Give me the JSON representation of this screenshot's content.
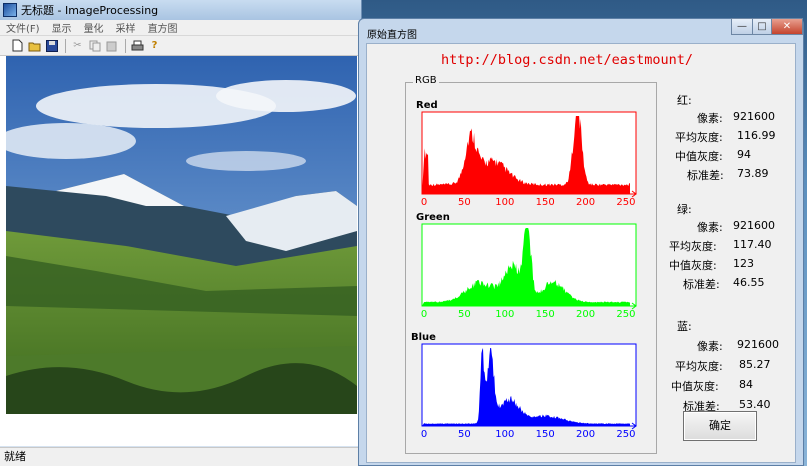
{
  "main_window": {
    "title": "无标题 - ImageProcessing",
    "menu": [
      "文件(F)",
      "显示",
      "量化",
      "采样",
      "直方图"
    ],
    "toolbar_icons": [
      "new-file-icon",
      "open-folder-icon",
      "save-icon",
      "cut-icon",
      "copy-icon",
      "paste-icon",
      "print-icon",
      "help-icon"
    ],
    "status": "就绪"
  },
  "dialog": {
    "title": "原始直方图",
    "buttons": {
      "minimize": "—",
      "maximize": "□",
      "close": "✕"
    },
    "url": "http://blog.csdn.net/eastmount/",
    "group_label": "RGB",
    "ok_label": "确定"
  },
  "histograms": [
    {
      "label": "Red",
      "color": "#ff0000",
      "ticks": [
        "0",
        "50",
        "100",
        "150",
        "200",
        "250"
      ]
    },
    {
      "label": "Green",
      "color": "#00ff00",
      "ticks": [
        "0",
        "50",
        "100",
        "150",
        "200",
        "250"
      ]
    },
    {
      "label": "Blue",
      "color": "#0000ff",
      "ticks": [
        "0",
        "50",
        "100",
        "150",
        "200",
        "250"
      ]
    }
  ],
  "stats": {
    "red": {
      "heading": "红:",
      "pixels_label": "像素:",
      "pixels": "921600",
      "mean_label": "平均灰度:",
      "mean": "116.99",
      "median_label": "中值灰度:",
      "median": "94",
      "std_label": "标准差:",
      "std": "73.89"
    },
    "green": {
      "heading": "绿:",
      "pixels_label": "像素:",
      "pixels": "921600",
      "mean_label": "平均灰度:",
      "mean": "117.40",
      "median_label": "中值灰度:",
      "median": "123",
      "std_label": "标准差:",
      "std": "46.55"
    },
    "blue": {
      "heading": "蓝:",
      "pixels_label": "像素:",
      "pixels": "921600",
      "mean_label": "平均灰度:",
      "mean": "85.27",
      "median_label": "中值灰度:",
      "median": "84",
      "std_label": "标准差:",
      "std": "53.40"
    }
  }
}
